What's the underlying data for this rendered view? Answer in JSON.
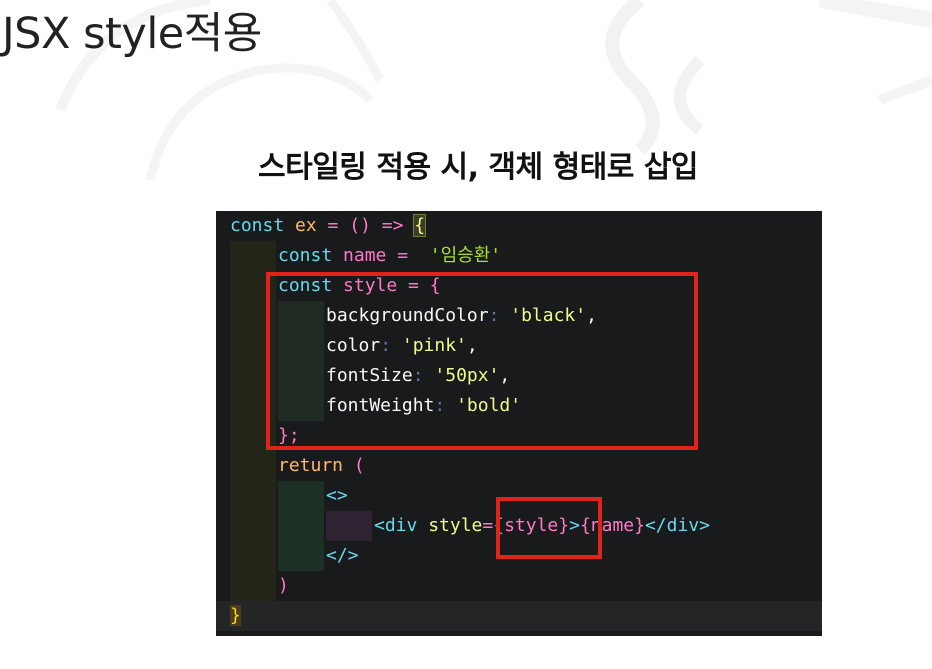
{
  "slide": {
    "title": "JSX style적용",
    "subtitle": "스타일링 적용 시, 객체 형태로 삽입"
  },
  "code": {
    "l1": {
      "kw": "const ",
      "name": "ex",
      "eq": " = () => ",
      "brace": "{"
    },
    "l2": {
      "kw": "const ",
      "name": "name",
      "eq": " =  ",
      "str": "'임승환'"
    },
    "l3": {
      "kw": "const ",
      "name": "style",
      "eq": " = {"
    },
    "l4": {
      "key": "backgroundColor",
      "colon": ": ",
      "val": "'black'",
      "comma": ","
    },
    "l5": {
      "key": "color",
      "colon": ": ",
      "val": "'pink'",
      "comma": ","
    },
    "l6": {
      "key": "fontSize",
      "colon": ": ",
      "val": "'50px'",
      "comma": ","
    },
    "l7": {
      "key": "fontWeight",
      "colon": ": ",
      "val": "'bold'"
    },
    "l8": {
      "close": "};"
    },
    "l9": {
      "kw": "return",
      "paren": " ("
    },
    "l10": {
      "frag": "<>"
    },
    "l11": {
      "open": "<div",
      "attr": " style",
      "eq": "=",
      "expr": "{style}",
      "gt": ">",
      "name_expr": "{name}",
      "close": "</div>"
    },
    "l12": {
      "frag": "</>"
    },
    "l13": {
      "paren": ")"
    },
    "l14": {
      "brace": "}"
    }
  },
  "colors": {
    "highlight_box": "#e0241a",
    "code_background": "#191a1c"
  }
}
